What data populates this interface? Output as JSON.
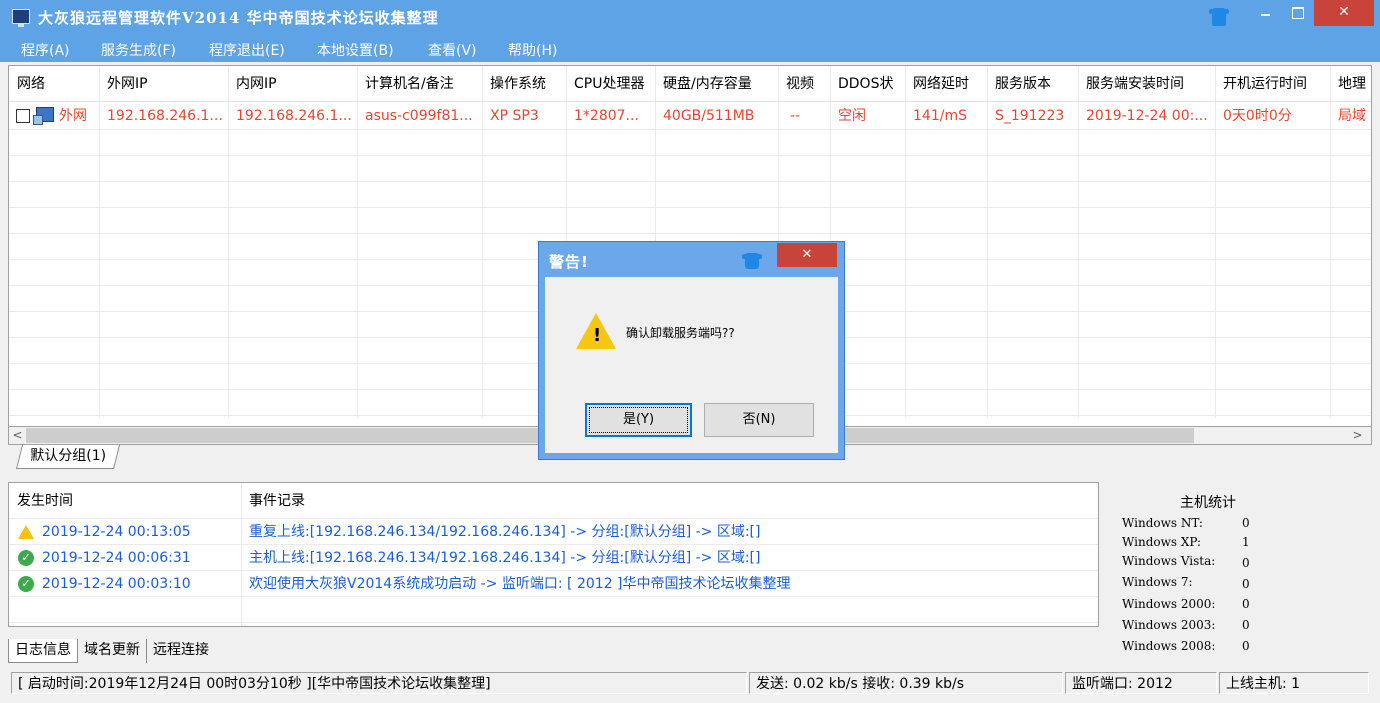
{
  "window": {
    "title": "大灰狼远程管理软件V2014   华中帝国技术论坛收集整理",
    "close_glyph": "✕"
  },
  "menu": [
    "程序(A)",
    "服务生成(F)",
    "程序退出(E)",
    "本地设置(B)",
    "查看(V)",
    "帮助(H)"
  ],
  "grid": {
    "columns": [
      "网络",
      "外网IP",
      "内网IP",
      "计算机名/备注",
      "操作系统",
      "CPU处理器",
      "硬盘/内存容量",
      "视频",
      "DDOS状",
      "网络延时",
      "服务版本",
      "服务端安装时间",
      "开机运行时间",
      "地理"
    ],
    "rows": [
      [
        "外网",
        "192.168.246.1...",
        "192.168.246.1...",
        "asus-c099f81...",
        "XP SP3",
        "1*2807...",
        "40GB/511MB",
        "--",
        "空闲",
        "141/mS",
        "S_191223",
        "2019-12-24 00:...",
        "0天0时0分",
        "局域"
      ]
    ]
  },
  "scroll": {
    "left": "<",
    "right": ">"
  },
  "group_tab": "默认分组(1)",
  "log": {
    "headers": {
      "time": "发生时间",
      "event": "事件记录"
    },
    "entries": [
      {
        "icon": "warning",
        "time": "2019-12-24 00:13:05",
        "message": "重复上线:[192.168.246.134/192.168.246.134] -> 分组:[默认分组] -> 区域:[]"
      },
      {
        "icon": "ok",
        "time": "2019-12-24 00:06:31",
        "message": "主机上线:[192.168.246.134/192.168.246.134] -> 分组:[默认分组] -> 区域:[]"
      },
      {
        "icon": "ok",
        "time": "2019-12-24 00:03:10",
        "message": "欢迎使用大灰狼V2014系统成功启动 -> 监听端口: [ 2012 ]华中帝国技术论坛收集整理"
      }
    ]
  },
  "bottom_tabs": [
    "日志信息",
    "域名更新",
    "远程连接"
  ],
  "stats": {
    "title": "主机统计",
    "rows": [
      {
        "label": "Windows NT:",
        "value": "0"
      },
      {
        "label": "Windows XP:",
        "value": "1"
      },
      {
        "label": "Windows Vista:",
        "value": "0"
      },
      {
        "label": "Windows 7:",
        "value": "0"
      },
      {
        "label": "Windows 2000:",
        "value": "0"
      },
      {
        "label": "Windows 2003:",
        "value": "0"
      },
      {
        "label": "Windows 2008:",
        "value": "0"
      }
    ]
  },
  "statusbar": {
    "startup": "[ 启动时间:2019年12月24日 00时03分10秒 ][华中帝国技术论坛收集整理]",
    "traffic": "发送: 0.02 kb/s 接收: 0.39 kb/s",
    "port": "监听端口: 2012",
    "online": "上线主机: 1"
  },
  "dialog": {
    "title": "警告!",
    "message": "确认卸载服务端吗??",
    "yes": "是(Y)",
    "no": "否(N)",
    "close_glyph": "✕",
    "warn_mark": "!"
  }
}
